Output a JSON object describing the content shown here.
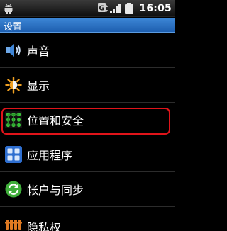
{
  "status_bar": {
    "time": "16:05",
    "icons": [
      "android-debug-icon",
      "data-g-icon",
      "signal-icon",
      "battery-icon"
    ]
  },
  "title_bar": {
    "title": "设置"
  },
  "settings": {
    "items": [
      {
        "label": "声音",
        "icon": "speaker-icon"
      },
      {
        "label": "显示",
        "icon": "brightness-icon"
      },
      {
        "label": "位置和安全",
        "icon": "lock-pattern-icon",
        "selected": true
      },
      {
        "label": "应用程序",
        "icon": "applications-grid-icon"
      },
      {
        "label": "帐户与同步",
        "icon": "sync-icon"
      },
      {
        "label": "隐私权",
        "icon": "privacy-icon"
      }
    ]
  },
  "colors": {
    "title_bar": "#2f7ad0",
    "selection_frame": "#e0141a",
    "background": "#000000"
  }
}
